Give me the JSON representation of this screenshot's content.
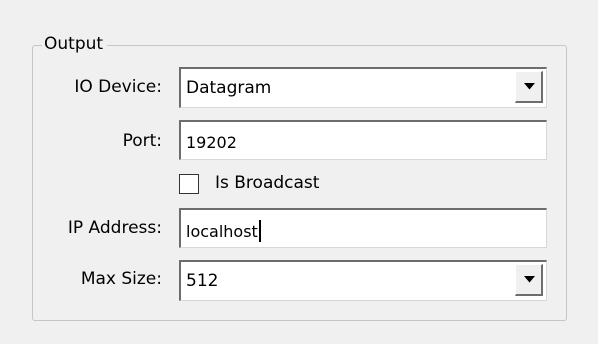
{
  "output_group": {
    "title": "Output",
    "io_device": {
      "label": "IO Device:",
      "selected": "Datagram"
    },
    "port": {
      "label": "Port:",
      "value": "19202"
    },
    "is_broadcast": {
      "label": "Is Broadcast",
      "checked": false
    },
    "ip_address": {
      "label": "IP Address:",
      "value": "localhost"
    },
    "max_size": {
      "label": "Max Size:",
      "selected": "512"
    }
  },
  "icons": {
    "dropdown_arrow": "chevron-down-icon"
  }
}
